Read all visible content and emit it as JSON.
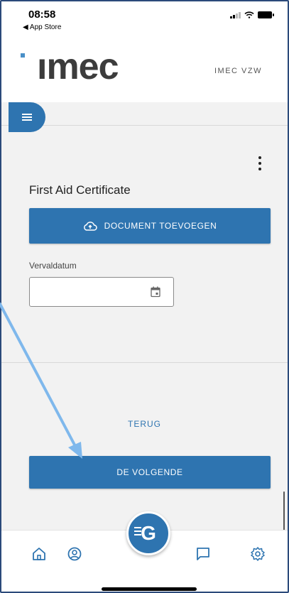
{
  "status_bar": {
    "time": "08:58",
    "back_label": "◀ App Store"
  },
  "header": {
    "logo_text": "ımec",
    "org_name": "IMEC VZW"
  },
  "form": {
    "title": "First Aid Certificate",
    "add_document_label": "DOCUMENT TOEVOEGEN",
    "expiry_label": "Vervaldatum",
    "expiry_value": ""
  },
  "actions": {
    "back_label": "TERUG",
    "next_label": "DE VOLGENDE"
  },
  "bottom_nav": {
    "items": [
      {
        "icon": "home-icon"
      },
      {
        "icon": "profile-icon"
      },
      {
        "icon": "g-logo-icon",
        "label": "G"
      },
      {
        "icon": "chat-icon"
      },
      {
        "icon": "settings-icon"
      }
    ]
  },
  "colors": {
    "primary": "#2e74b0",
    "background": "#f2f2f2",
    "annotation_arrow": "#7fb8ec"
  }
}
